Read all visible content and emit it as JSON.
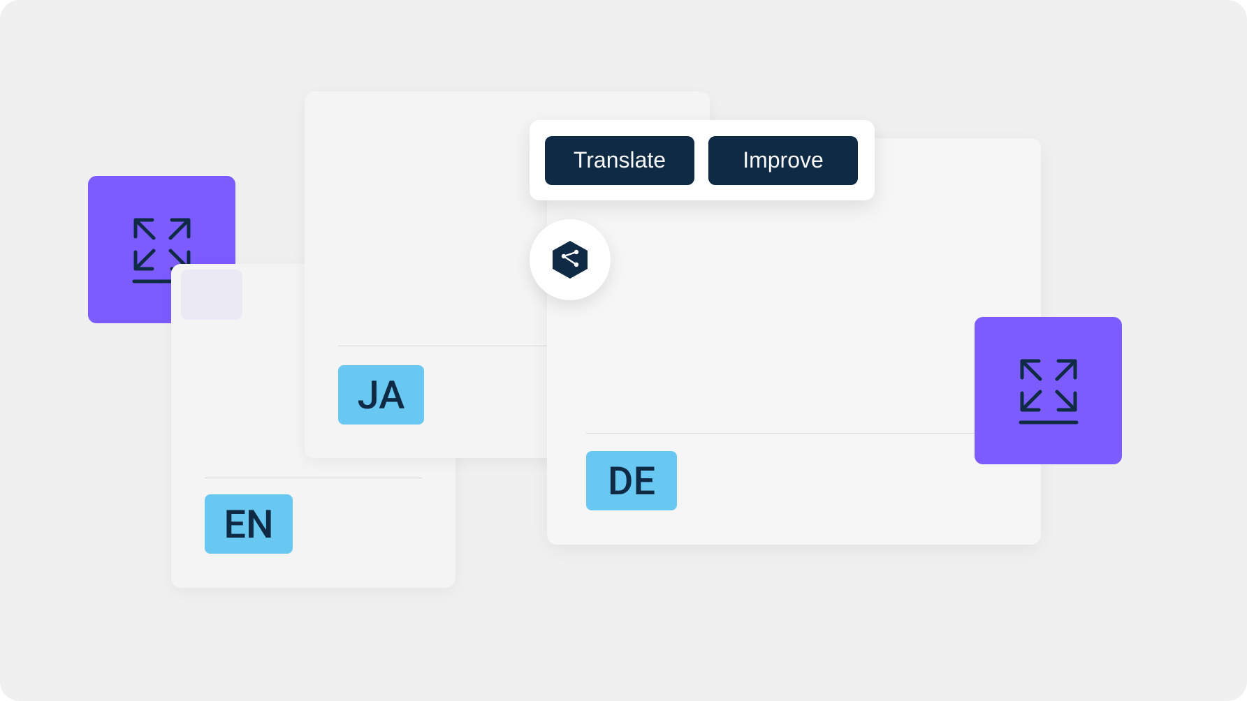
{
  "toolbar": {
    "translate_label": "Translate",
    "improve_label": "Improve"
  },
  "cards": {
    "en": {
      "lang": "EN"
    },
    "ja": {
      "lang": "JA"
    },
    "de": {
      "lang": "DE"
    }
  },
  "icons": {
    "expand": "expand-icon",
    "brand": "brand-chat-icon"
  },
  "colors": {
    "purple": "#7c5cff",
    "blue_badge": "#69c8f2",
    "dark_navy": "#0f2a44",
    "canvas_bg": "#f0f0f0",
    "card_bg": "#f4f4f4"
  }
}
